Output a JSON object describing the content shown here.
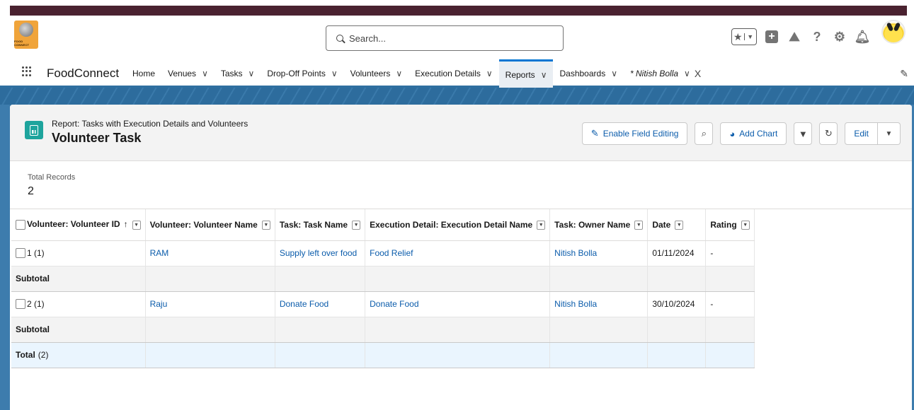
{
  "header": {
    "logo_text": "FOOD CONNECT",
    "search_placeholder": "Search..."
  },
  "nav": {
    "app_name": "FoodConnect",
    "items": [
      {
        "label": "Home",
        "chevron": false
      },
      {
        "label": "Venues",
        "chevron": true
      },
      {
        "label": "Tasks",
        "chevron": true
      },
      {
        "label": "Drop-Off Points",
        "chevron": true
      },
      {
        "label": "Volunteers",
        "chevron": true
      },
      {
        "label": "Execution Details",
        "chevron": true
      },
      {
        "label": "Reports",
        "chevron": true,
        "active": true
      },
      {
        "label": "Dashboards",
        "chevron": true
      },
      {
        "label": "* Nitish Bolla",
        "chevron": true,
        "closable": true
      }
    ]
  },
  "report": {
    "breadcrumb": "Report: Tasks with Execution Details and Volunteers",
    "title": "Volunteer Task",
    "buttons": {
      "enable_field_editing": "Enable Field Editing",
      "add_chart": "Add Chart",
      "edit": "Edit"
    },
    "total_records_label": "Total Records",
    "total_records_value": "2"
  },
  "table": {
    "columns": [
      "Volunteer: Volunteer ID",
      "Volunteer: Volunteer Name",
      "Task: Task Name",
      "Execution Detail: Execution Detail Name",
      "Task: Owner Name",
      "Date",
      "Rating"
    ],
    "sort_indicator": "↑",
    "groups": [
      {
        "group_label": "1 (1)",
        "row": [
          "RAM",
          "Supply left over food",
          "Food Relief",
          "Nitish Bolla",
          "01/11/2024",
          "-"
        ],
        "subtotal_label": "Subtotal"
      },
      {
        "group_label": "2 (1)",
        "row": [
          "Raju",
          "Donate Food",
          "Donate Food",
          "Nitish Bolla",
          "30/10/2024",
          "-"
        ],
        "subtotal_label": "Subtotal"
      }
    ],
    "total_label": "Total",
    "total_count": "(2)"
  },
  "colors": {
    "brand_blue": "#0176d3",
    "link_blue": "#0b5cab",
    "report_icon": "#1ea49d",
    "banner": "#2d6c9d"
  }
}
